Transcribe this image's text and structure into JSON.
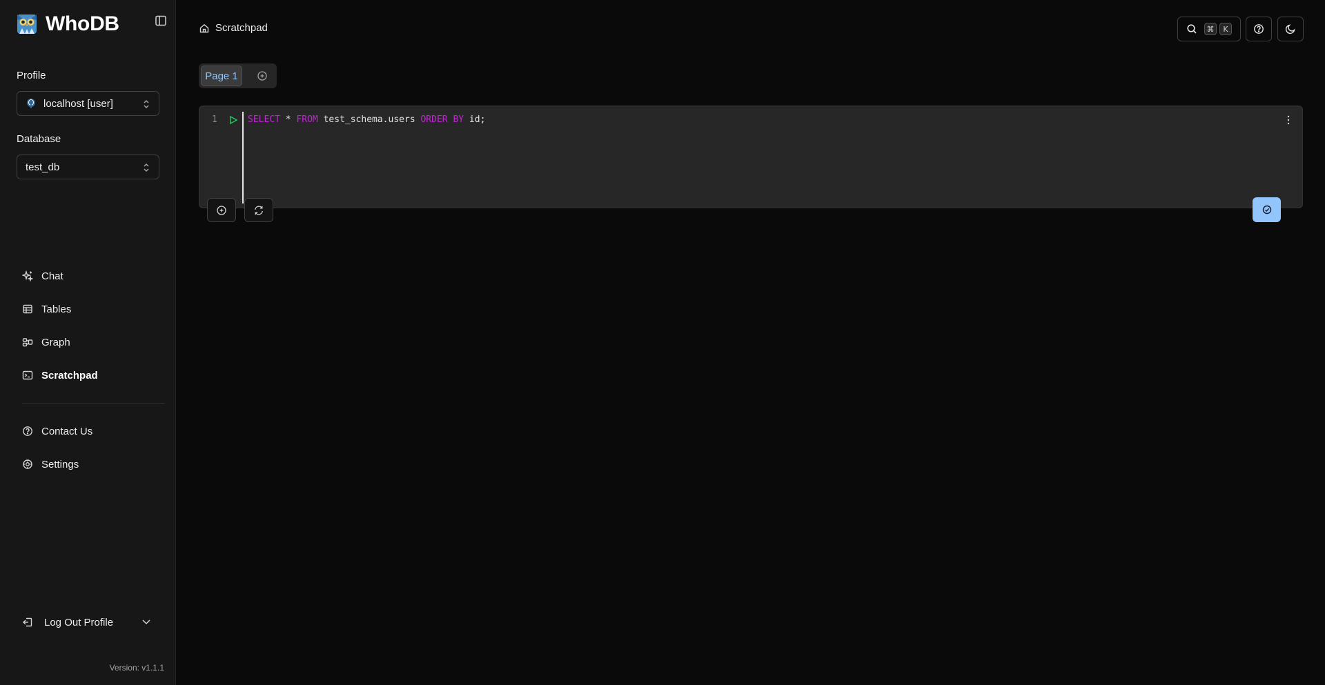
{
  "app": {
    "name": "WhoDB",
    "version": "Version: v1.1.1"
  },
  "sidebar": {
    "profile_label": "Profile",
    "profile_value": "localhost [user]",
    "database_label": "Database",
    "database_value": "test_db",
    "items": [
      {
        "label": "Chat",
        "icon": "sparkles-icon"
      },
      {
        "label": "Tables",
        "icon": "table-icon"
      },
      {
        "label": "Graph",
        "icon": "graph-icon"
      },
      {
        "label": "Scratchpad",
        "icon": "terminal-icon",
        "active": true
      }
    ],
    "secondary_items": [
      {
        "label": "Contact Us",
        "icon": "help-circle-icon"
      },
      {
        "label": "Settings",
        "icon": "gear-icon"
      }
    ],
    "logout_label": "Log Out Profile"
  },
  "header": {
    "breadcrumb": "Scratchpad",
    "shortcut_keys": [
      "⌘",
      "K"
    ]
  },
  "tabs": [
    {
      "label": "Page 1",
      "active": true
    }
  ],
  "editor": {
    "line_number": "1",
    "code_tokens": [
      {
        "text": "SELECT",
        "kw": true
      },
      {
        "text": " * ",
        "kw": false
      },
      {
        "text": "FROM",
        "kw": true
      },
      {
        "text": " test_schema.users ",
        "kw": false
      },
      {
        "text": "ORDER BY",
        "kw": true
      },
      {
        "text": " id;",
        "kw": false
      }
    ]
  },
  "colors": {
    "background": "#0a0a0a",
    "sidebar": "#171717",
    "accent": "#93c5fd",
    "keyword": "#c026d3",
    "run": "#22c55e"
  }
}
